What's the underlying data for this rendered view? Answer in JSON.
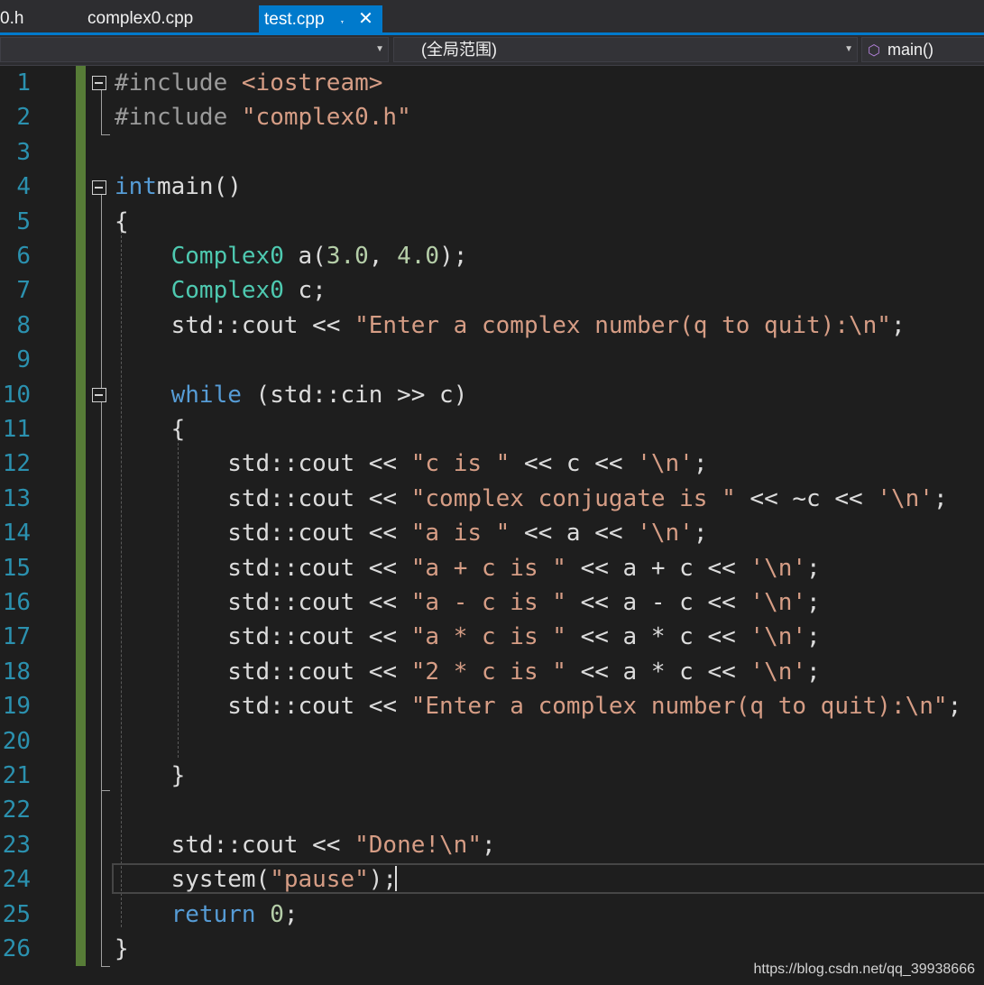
{
  "tabs": [
    {
      "label": "0.h"
    },
    {
      "label": "complex0.cpp"
    },
    {
      "label": "test.cpp",
      "active": true
    }
  ],
  "navbar": {
    "scope_label": "(全局范围)",
    "member_label": "main()"
  },
  "editor": {
    "line_numbers": [
      "1",
      "2",
      "3",
      "4",
      "5",
      "6",
      "7",
      "8",
      "9",
      "10",
      "11",
      "12",
      "13",
      "14",
      "15",
      "16",
      "17",
      "18",
      "19",
      "20",
      "21",
      "22",
      "23",
      "24",
      "25",
      "26"
    ],
    "code_lines": [
      [
        [
          "pp",
          "#include "
        ],
        [
          "str",
          "<iostream>"
        ]
      ],
      [
        [
          "pp",
          "#include "
        ],
        [
          "str",
          "\"complex0.h\""
        ]
      ],
      [],
      [
        [
          "kw",
          "int"
        ],
        [
          "",
          "main()"
        ]
      ],
      [
        [
          "",
          "{"
        ]
      ],
      [
        [
          "",
          "    "
        ],
        [
          "ty",
          "Complex0"
        ],
        [
          "",
          " a("
        ],
        [
          "num",
          "3.0"
        ],
        [
          "",
          ", "
        ],
        [
          "num",
          "4.0"
        ],
        [
          "",
          ");"
        ]
      ],
      [
        [
          "",
          "    "
        ],
        [
          "ty",
          "Complex0"
        ],
        [
          "",
          " c;"
        ]
      ],
      [
        [
          "",
          "    std::cout << "
        ],
        [
          "str",
          "\"Enter a complex number(q to quit):\\n\""
        ],
        [
          "",
          ";"
        ]
      ],
      [],
      [
        [
          "",
          "    "
        ],
        [
          "kw",
          "while"
        ],
        [
          "",
          " (std::cin >> c)"
        ]
      ],
      [
        [
          "",
          "    {"
        ]
      ],
      [
        [
          "",
          "        std::cout << "
        ],
        [
          "str",
          "\"c is \""
        ],
        [
          "",
          " << c << "
        ],
        [
          "str",
          "'\\n'"
        ],
        [
          "",
          ";"
        ]
      ],
      [
        [
          "",
          "        std::cout << "
        ],
        [
          "str",
          "\"complex conjugate is \""
        ],
        [
          "",
          " << ~c << "
        ],
        [
          "str",
          "'\\n'"
        ],
        [
          "",
          ";"
        ]
      ],
      [
        [
          "",
          "        std::cout << "
        ],
        [
          "str",
          "\"a is \""
        ],
        [
          "",
          " << a << "
        ],
        [
          "str",
          "'\\n'"
        ],
        [
          "",
          ";"
        ]
      ],
      [
        [
          "",
          "        std::cout << "
        ],
        [
          "str",
          "\"a + c is \""
        ],
        [
          "",
          " << a + c << "
        ],
        [
          "str",
          "'\\n'"
        ],
        [
          "",
          ";"
        ]
      ],
      [
        [
          "",
          "        std::cout << "
        ],
        [
          "str",
          "\"a - c is \""
        ],
        [
          "",
          " << a - c << "
        ],
        [
          "str",
          "'\\n'"
        ],
        [
          "",
          ";"
        ]
      ],
      [
        [
          "",
          "        std::cout << "
        ],
        [
          "str",
          "\"a * c is \""
        ],
        [
          "",
          " << a * c << "
        ],
        [
          "str",
          "'\\n'"
        ],
        [
          "",
          ";"
        ]
      ],
      [
        [
          "",
          "        std::cout << "
        ],
        [
          "str",
          "\"2 * c is \""
        ],
        [
          "",
          " << a * c << "
        ],
        [
          "str",
          "'\\n'"
        ],
        [
          "",
          ";"
        ]
      ],
      [
        [
          "",
          "        std::cout << "
        ],
        [
          "str",
          "\"Enter a complex number(q to quit):\\n\""
        ],
        [
          "",
          ";"
        ]
      ],
      [],
      [
        [
          "",
          "    }"
        ]
      ],
      [],
      [
        [
          "",
          "    std::cout << "
        ],
        [
          "str",
          "\"Done!\\n\""
        ],
        [
          "",
          ";"
        ]
      ],
      [
        [
          "",
          "    system("
        ],
        [
          "str",
          "\"pause\""
        ],
        [
          "",
          ");"
        ]
      ],
      [
        [
          "",
          "    "
        ],
        [
          "kw",
          "return"
        ],
        [
          "",
          " "
        ],
        [
          "num",
          "0"
        ],
        [
          "",
          ";"
        ]
      ],
      [
        [
          "",
          "}"
        ]
      ]
    ]
  },
  "watermark": "https://blog.csdn.net/qq_39938666",
  "colors": {
    "background": "#1e1e1e",
    "keyword": "#569cd6",
    "string": "#d69d85",
    "type": "#4ec9b0",
    "number": "#b5cea8",
    "preprocessor": "#9b9b9b",
    "line_number": "#2b91af",
    "accent": "#007acc",
    "change_bar": "#577c37"
  },
  "icons": {
    "pin": "pin-icon",
    "close": "close-icon",
    "member": "cube-icon",
    "dropdown": "chevron-down-icon",
    "fold": "fold-minus-icon"
  }
}
